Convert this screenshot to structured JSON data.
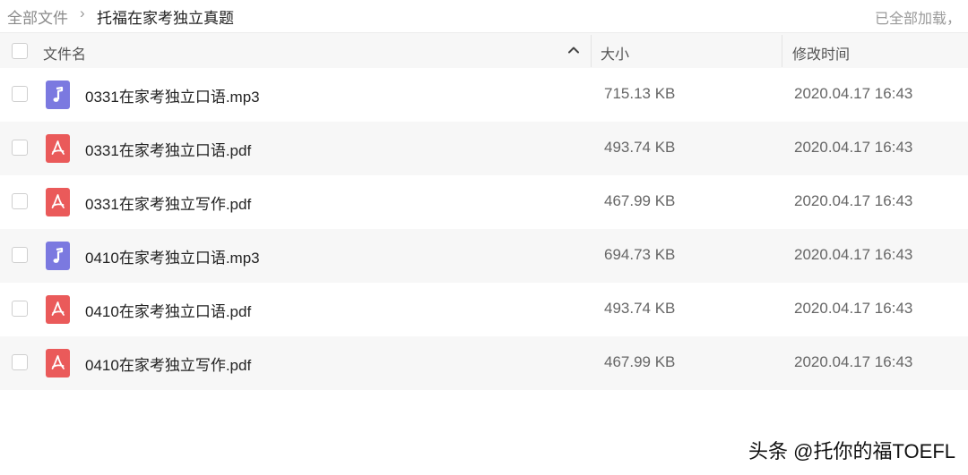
{
  "breadcrumb": {
    "root": "全部文件",
    "separator": "›",
    "current": "托福在家考独立真题"
  },
  "load_status": "已全部加载，",
  "columns": {
    "name": "文件名",
    "size": "大小",
    "modified": "修改时间"
  },
  "files": [
    {
      "name": "0331在家考独立口语.mp3",
      "size": "715.13 KB",
      "modified": "2020.04.17 16:43",
      "icon": "audio-file-icon"
    },
    {
      "name": "0331在家考独立口语.pdf",
      "size": "493.74 KB",
      "modified": "2020.04.17 16:43",
      "icon": "pdf-file-icon"
    },
    {
      "name": "0331在家考独立写作.pdf",
      "size": "467.99 KB",
      "modified": "2020.04.17 16:43",
      "icon": "pdf-file-icon"
    },
    {
      "name": "0410在家考独立口语.mp3",
      "size": "694.73 KB",
      "modified": "2020.04.17 16:43",
      "icon": "audio-file-icon"
    },
    {
      "name": "0410在家考独立口语.pdf",
      "size": "493.74 KB",
      "modified": "2020.04.17 16:43",
      "icon": "pdf-file-icon"
    },
    {
      "name": "0410在家考独立写作.pdf",
      "size": "467.99 KB",
      "modified": "2020.04.17 16:43",
      "icon": "pdf-file-icon"
    }
  ],
  "watermark": "头条 @托你的福TOEFL",
  "colors": {
    "audio_icon": "#7b79e0",
    "pdf_icon": "#ea5a5a",
    "row_alt": "#f7f7f7"
  }
}
